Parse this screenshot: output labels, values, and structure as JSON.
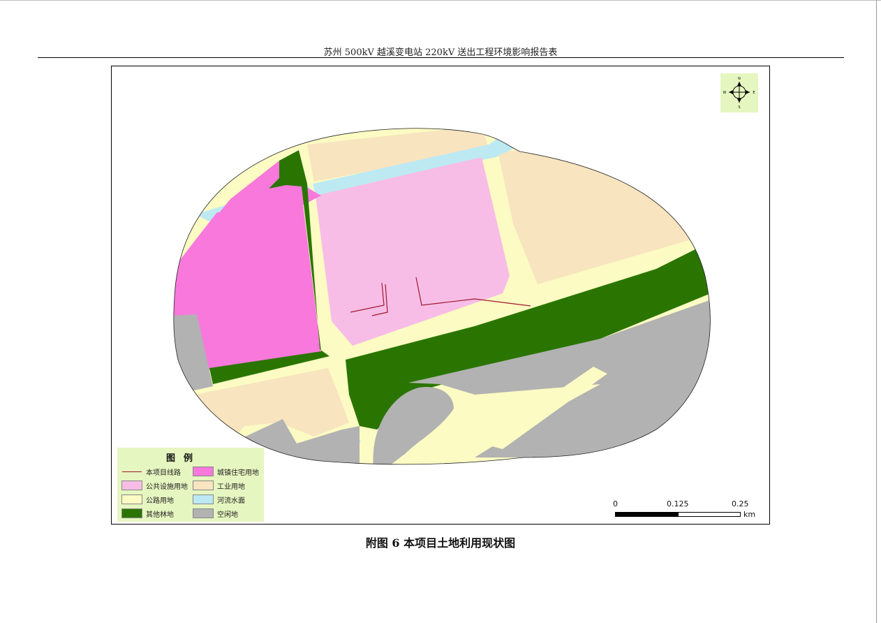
{
  "header": {
    "title": "苏州 500kV 越溪变电站 220kV 送出工程环境影响报告表"
  },
  "map": {
    "colors": {
      "residential": "#f878dc",
      "public": "#f7bde6",
      "industrial": "#f8e4bf",
      "road": "#fbfbc3",
      "water": "#bde9f3",
      "forest": "#2a7501",
      "vacant": "#b2b2b2",
      "route": "#a0182e"
    },
    "compass": {
      "n": "N",
      "s": "S",
      "e": "E",
      "w": "W"
    },
    "legend": {
      "title": "图例",
      "items": [
        {
          "label": "本项目线路",
          "kind": "line",
          "color": "#a0182e"
        },
        {
          "label": "城镇住宅用地",
          "kind": "fill",
          "color": "#f878dc"
        },
        {
          "label": "公共设施用地",
          "kind": "fill",
          "color": "#f7bde6"
        },
        {
          "label": "工业用地",
          "kind": "fill",
          "color": "#f8e4bf"
        },
        {
          "label": "公路用地",
          "kind": "fill",
          "color": "#fbfbc3"
        },
        {
          "label": "河流水面",
          "kind": "fill",
          "color": "#bde9f3"
        },
        {
          "label": "其他林地",
          "kind": "fill",
          "color": "#2a7501"
        },
        {
          "label": "空闲地",
          "kind": "fill",
          "color": "#b2b2b2"
        }
      ]
    },
    "scale": {
      "ticks": [
        "0",
        "0.125",
        "0.25"
      ],
      "unit": "km"
    }
  },
  "caption": {
    "text": "附图 6  本项目土地利用现状图"
  }
}
